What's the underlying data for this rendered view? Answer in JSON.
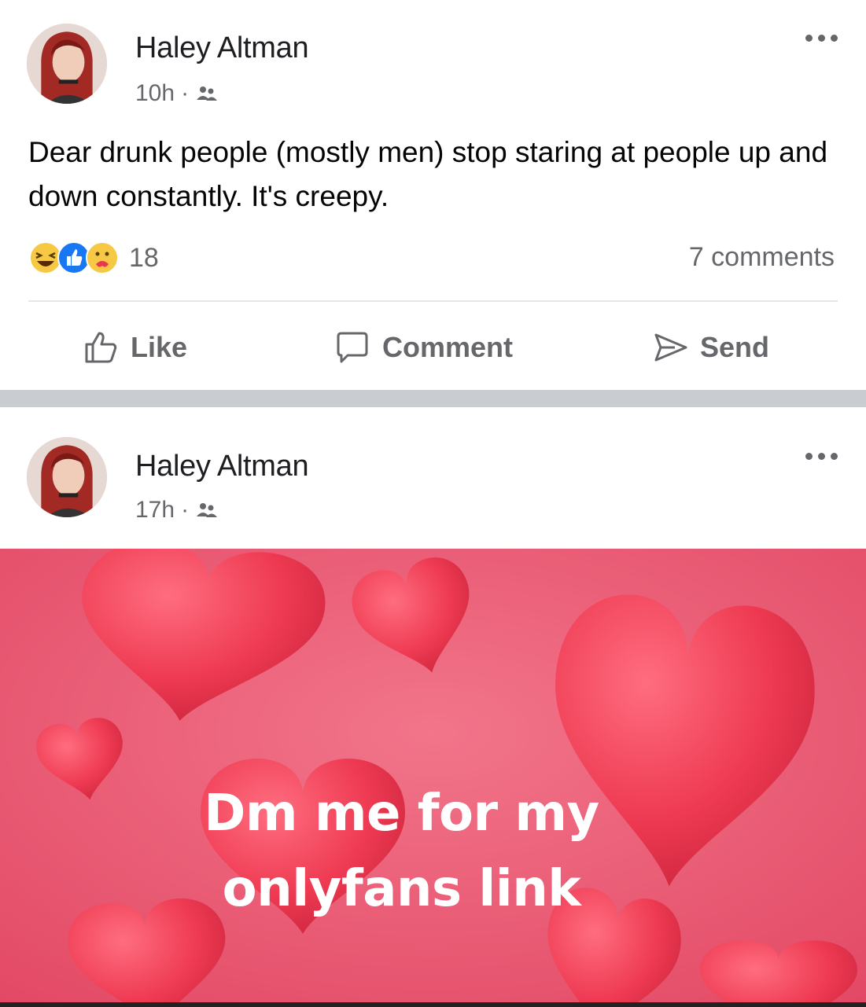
{
  "post1": {
    "author": "Haley Altman",
    "time": "10h",
    "audience_icon": "friends-icon",
    "body": "Dear drunk people (mostly men) stop staring at people up and down constantly. It's creepy.",
    "reaction_icons": [
      "haha-icon",
      "like-icon",
      "care-icon"
    ],
    "reaction_count": "18",
    "comments_count": "7 comments",
    "actions": {
      "like": "Like",
      "comment": "Comment",
      "send": "Send"
    }
  },
  "post2": {
    "author": "Haley Altman",
    "time": "17h",
    "audience_icon": "friends-icon",
    "image_text": {
      "line1": "Dm me for my",
      "line2": "onlyfans link"
    }
  },
  "colors": {
    "secondary_text": "#65676b",
    "divider": "#c9ccd1",
    "image_background": "#e8506b",
    "heart": "#e8374f"
  }
}
